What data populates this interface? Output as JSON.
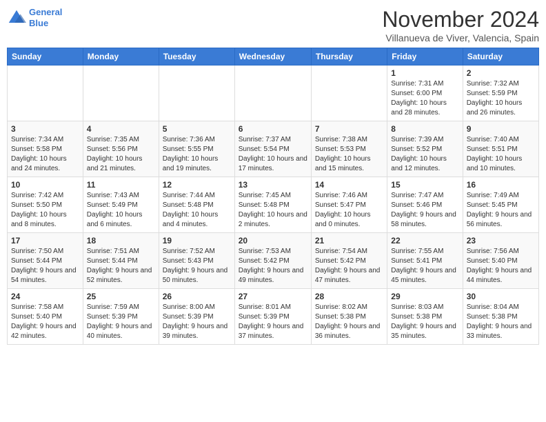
{
  "header": {
    "logo_line1": "General",
    "logo_line2": "Blue",
    "month": "November 2024",
    "location": "Villanueva de Viver, Valencia, Spain"
  },
  "days_of_week": [
    "Sunday",
    "Monday",
    "Tuesday",
    "Wednesday",
    "Thursday",
    "Friday",
    "Saturday"
  ],
  "weeks": [
    [
      {
        "day": null,
        "info": null
      },
      {
        "day": null,
        "info": null
      },
      {
        "day": null,
        "info": null
      },
      {
        "day": null,
        "info": null
      },
      {
        "day": null,
        "info": null
      },
      {
        "day": "1",
        "info": "Sunrise: 7:31 AM\nSunset: 6:00 PM\nDaylight: 10 hours and 28 minutes."
      },
      {
        "day": "2",
        "info": "Sunrise: 7:32 AM\nSunset: 5:59 PM\nDaylight: 10 hours and 26 minutes."
      }
    ],
    [
      {
        "day": "3",
        "info": "Sunrise: 7:34 AM\nSunset: 5:58 PM\nDaylight: 10 hours and 24 minutes."
      },
      {
        "day": "4",
        "info": "Sunrise: 7:35 AM\nSunset: 5:56 PM\nDaylight: 10 hours and 21 minutes."
      },
      {
        "day": "5",
        "info": "Sunrise: 7:36 AM\nSunset: 5:55 PM\nDaylight: 10 hours and 19 minutes."
      },
      {
        "day": "6",
        "info": "Sunrise: 7:37 AM\nSunset: 5:54 PM\nDaylight: 10 hours and 17 minutes."
      },
      {
        "day": "7",
        "info": "Sunrise: 7:38 AM\nSunset: 5:53 PM\nDaylight: 10 hours and 15 minutes."
      },
      {
        "day": "8",
        "info": "Sunrise: 7:39 AM\nSunset: 5:52 PM\nDaylight: 10 hours and 12 minutes."
      },
      {
        "day": "9",
        "info": "Sunrise: 7:40 AM\nSunset: 5:51 PM\nDaylight: 10 hours and 10 minutes."
      }
    ],
    [
      {
        "day": "10",
        "info": "Sunrise: 7:42 AM\nSunset: 5:50 PM\nDaylight: 10 hours and 8 minutes."
      },
      {
        "day": "11",
        "info": "Sunrise: 7:43 AM\nSunset: 5:49 PM\nDaylight: 10 hours and 6 minutes."
      },
      {
        "day": "12",
        "info": "Sunrise: 7:44 AM\nSunset: 5:48 PM\nDaylight: 10 hours and 4 minutes."
      },
      {
        "day": "13",
        "info": "Sunrise: 7:45 AM\nSunset: 5:48 PM\nDaylight: 10 hours and 2 minutes."
      },
      {
        "day": "14",
        "info": "Sunrise: 7:46 AM\nSunset: 5:47 PM\nDaylight: 10 hours and 0 minutes."
      },
      {
        "day": "15",
        "info": "Sunrise: 7:47 AM\nSunset: 5:46 PM\nDaylight: 9 hours and 58 minutes."
      },
      {
        "day": "16",
        "info": "Sunrise: 7:49 AM\nSunset: 5:45 PM\nDaylight: 9 hours and 56 minutes."
      }
    ],
    [
      {
        "day": "17",
        "info": "Sunrise: 7:50 AM\nSunset: 5:44 PM\nDaylight: 9 hours and 54 minutes."
      },
      {
        "day": "18",
        "info": "Sunrise: 7:51 AM\nSunset: 5:44 PM\nDaylight: 9 hours and 52 minutes."
      },
      {
        "day": "19",
        "info": "Sunrise: 7:52 AM\nSunset: 5:43 PM\nDaylight: 9 hours and 50 minutes."
      },
      {
        "day": "20",
        "info": "Sunrise: 7:53 AM\nSunset: 5:42 PM\nDaylight: 9 hours and 49 minutes."
      },
      {
        "day": "21",
        "info": "Sunrise: 7:54 AM\nSunset: 5:42 PM\nDaylight: 9 hours and 47 minutes."
      },
      {
        "day": "22",
        "info": "Sunrise: 7:55 AM\nSunset: 5:41 PM\nDaylight: 9 hours and 45 minutes."
      },
      {
        "day": "23",
        "info": "Sunrise: 7:56 AM\nSunset: 5:40 PM\nDaylight: 9 hours and 44 minutes."
      }
    ],
    [
      {
        "day": "24",
        "info": "Sunrise: 7:58 AM\nSunset: 5:40 PM\nDaylight: 9 hours and 42 minutes."
      },
      {
        "day": "25",
        "info": "Sunrise: 7:59 AM\nSunset: 5:39 PM\nDaylight: 9 hours and 40 minutes."
      },
      {
        "day": "26",
        "info": "Sunrise: 8:00 AM\nSunset: 5:39 PM\nDaylight: 9 hours and 39 minutes."
      },
      {
        "day": "27",
        "info": "Sunrise: 8:01 AM\nSunset: 5:39 PM\nDaylight: 9 hours and 37 minutes."
      },
      {
        "day": "28",
        "info": "Sunrise: 8:02 AM\nSunset: 5:38 PM\nDaylight: 9 hours and 36 minutes."
      },
      {
        "day": "29",
        "info": "Sunrise: 8:03 AM\nSunset: 5:38 PM\nDaylight: 9 hours and 35 minutes."
      },
      {
        "day": "30",
        "info": "Sunrise: 8:04 AM\nSunset: 5:38 PM\nDaylight: 9 hours and 33 minutes."
      }
    ]
  ]
}
